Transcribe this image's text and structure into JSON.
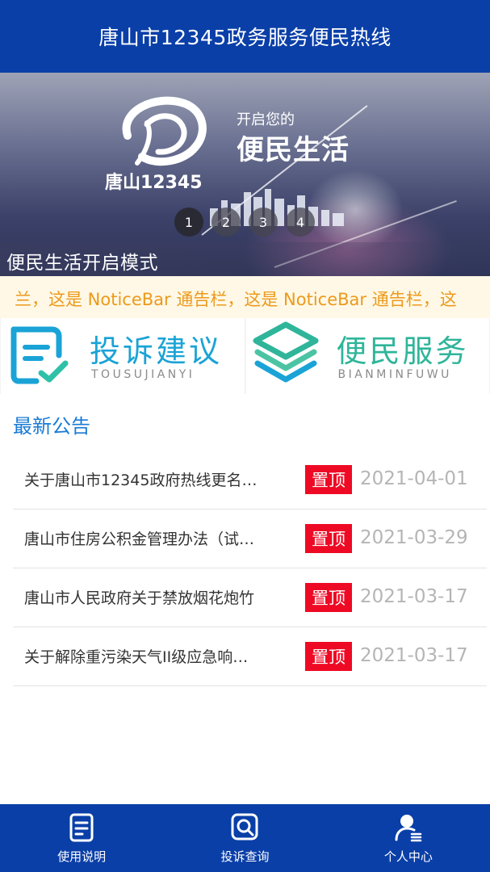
{
  "header": {
    "title": "唐山市12345政务服务便民热线"
  },
  "banner": {
    "logo_text": "唐山12345",
    "tagline_small": "开启您的",
    "tagline_big": "便民生活",
    "caption": "便民生活开启模式",
    "dots": [
      "1",
      "2",
      "3",
      "4"
    ],
    "active_dot": 1
  },
  "noticebar": {
    "text": "兰，这是 NoticeBar 通告栏，这是 NoticeBar 通告栏，这"
  },
  "features": [
    {
      "title": "投诉建议",
      "subtitle": "TOUSUJIANYI",
      "icon": "document-check-icon",
      "color": "#1aa3d6"
    },
    {
      "title": "便民服务",
      "subtitle": "BIANMINFUWU",
      "icon": "layers-icon",
      "color": "#2fb59a"
    }
  ],
  "announcements": {
    "title": "最新公告",
    "items": [
      {
        "title": "关于唐山市12345政府热线更名…",
        "badge": "置顶",
        "date": "2021-04-01"
      },
      {
        "title": "唐山市住房公积金管理办法（试…",
        "badge": "置顶",
        "date": "2021-03-29"
      },
      {
        "title": "唐山市人民政府关于禁放烟花炮竹",
        "badge": "置顶",
        "date": "2021-03-17"
      },
      {
        "title": "关于解除重污染天气II级应急响…",
        "badge": "置顶",
        "date": "2021-03-17"
      }
    ]
  },
  "tabbar": [
    {
      "label": "使用说明",
      "icon": "document-icon"
    },
    {
      "label": "投诉查询",
      "icon": "search-icon"
    },
    {
      "label": "个人中心",
      "icon": "user-icon"
    }
  ],
  "colors": {
    "primary": "#0a3fa8",
    "accent": "#1a7bd6",
    "badge": "#ee0a24",
    "notice": "#ec9a1c"
  }
}
